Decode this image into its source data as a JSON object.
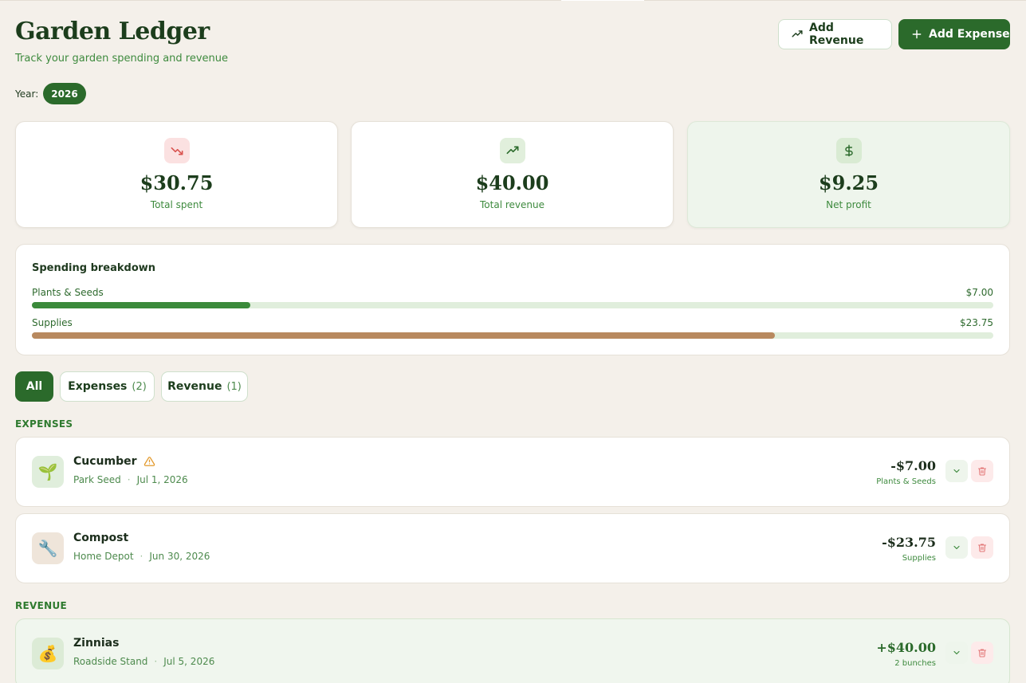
{
  "header": {
    "title": "Garden Ledger",
    "subtitle": "Track your garden spending and revenue",
    "add_revenue_label": "Add Revenue",
    "add_expense_label": "Add Expense"
  },
  "year": {
    "label": "Year:",
    "value": "2026"
  },
  "summary": [
    {
      "amount": "$30.75",
      "label": "Total spent",
      "icon": "trending-down-icon",
      "color": "#d9534f"
    },
    {
      "amount": "$40.00",
      "label": "Total revenue",
      "icon": "trending-up-icon",
      "color": "#2b6a2b"
    },
    {
      "amount": "$9.25",
      "label": "Net profit",
      "icon": "dollar-icon",
      "color": "#2b6a2b"
    }
  ],
  "breakdown": {
    "title": "Spending breakdown",
    "items": [
      {
        "name": "Plants & Seeds",
        "value": "$7.00",
        "fraction": 0.2276,
        "color": "#3b8a3b"
      },
      {
        "name": "Supplies",
        "value": "$23.75",
        "fraction": 0.7724,
        "color": "#b8895f"
      }
    ]
  },
  "tabs": [
    {
      "label": "All",
      "count": ""
    },
    {
      "label": "Expenses",
      "count": "(2)"
    },
    {
      "label": "Revenue",
      "count": "(1)"
    }
  ],
  "sections": {
    "expenses": "EXPENSES",
    "revenue": "REVENUE"
  },
  "expenses": [
    {
      "name": "Cucumber",
      "vendor": "Park Seed",
      "date": "Jul 1, 2026",
      "amount": "-$7.00",
      "category": "Plants & Seeds",
      "icon": "seedling-icon",
      "emoji": "🌱",
      "warning": true
    },
    {
      "name": "Compost",
      "vendor": "Home Depot",
      "date": "Jun 30, 2026",
      "amount": "-$23.75",
      "category": "Supplies",
      "icon": "wrench-icon",
      "emoji": "🔧",
      "warning": false
    }
  ],
  "revenue": [
    {
      "name": "Zinnias",
      "vendor": "Roadside Stand",
      "date": "Jul 5, 2026",
      "amount": "+$40.00",
      "detail": "2 bunches",
      "icon": "money-bag-icon",
      "emoji": "💰"
    }
  ]
}
